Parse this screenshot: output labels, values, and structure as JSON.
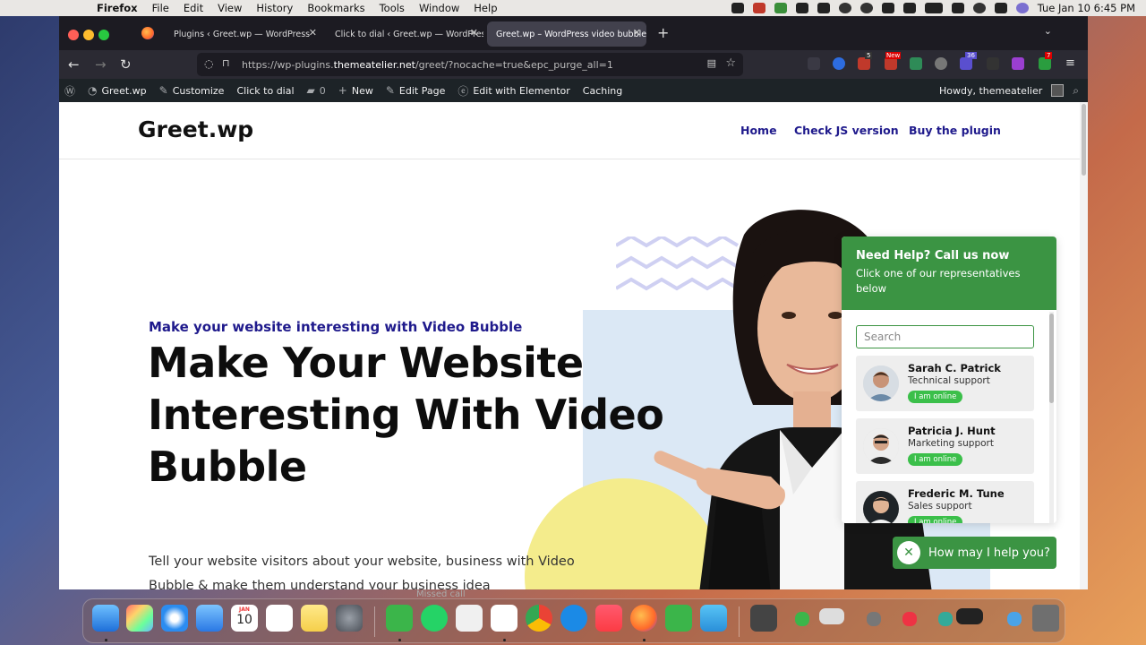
{
  "macos": {
    "menu": [
      "Firefox",
      "File",
      "Edit",
      "View",
      "History",
      "Bookmarks",
      "Tools",
      "Window",
      "Help"
    ],
    "clock": "Tue Jan 10  6:45 PM"
  },
  "browser": {
    "tabs": [
      {
        "label": "Plugins ‹ Greet.wp — WordPress"
      },
      {
        "label": "Click to dial ‹ Greet.wp — WordPress"
      },
      {
        "label": "Greet.wp – WordPress video bubble"
      }
    ],
    "url_prefix": "https://wp-plugins.",
    "url_domain": "themeatelier.net",
    "url_suffix": "/greet/?nocache=true&epc_purge_all=1",
    "ext_badges": {
      "b1": "5",
      "b2": "New",
      "b3": "36",
      "b4": "7"
    }
  },
  "adminbar": {
    "site": "Greet.wp",
    "customize": "Customize",
    "click_to_dial": "Click to dial",
    "comments": "0",
    "new": "New",
    "edit_page": "Edit Page",
    "elementor": "Edit with Elementor",
    "caching": "Caching",
    "howdy": "Howdy, themeatelier"
  },
  "site": {
    "logo": "Greet.wp",
    "nav": [
      "Home",
      "Check JS version",
      "Buy the plugin"
    ],
    "kicker": "Make your website interesting with Video Bubble",
    "hero": "Make Your Website Interesting With Video Bubble",
    "body": "Tell your website visitors about your website, business with Video Bubble & make them understand your business idea"
  },
  "widget": {
    "title": "Need Help? Call us now",
    "subtitle": "Click one of our representatives below",
    "search_placeholder": "Search",
    "agents": [
      {
        "name": "Sarah C. Patrick",
        "role": "Technical support",
        "status": "I am online"
      },
      {
        "name": "Patricia J. Hunt",
        "role": "Marketing support",
        "status": "I am online"
      },
      {
        "name": "Frederic M. Tune",
        "role": "Sales support",
        "status": "I am online"
      }
    ],
    "cta": "How may I help you?"
  },
  "dock": {
    "calendar_month": "JAN",
    "calendar_day": "10",
    "ghost": "Missed call"
  },
  "colors": {
    "brand_green": "#3b9443",
    "nav_purple": "#1f1a8c",
    "online_green": "#3bbf4a"
  }
}
